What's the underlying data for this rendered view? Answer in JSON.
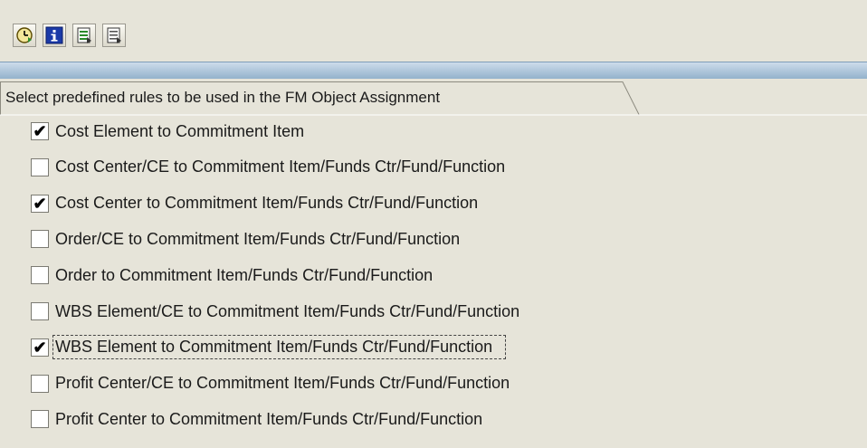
{
  "toolbar": {
    "buttons": [
      {
        "icon": "execute-clock-icon"
      },
      {
        "icon": "information-icon"
      },
      {
        "icon": "select-all-icon"
      },
      {
        "icon": "deselect-all-icon"
      }
    ]
  },
  "group": {
    "title": "Select  predefined rules to be used in the FM Object  Assignment"
  },
  "rules": [
    {
      "label": "Cost Element to Commitment Item",
      "checked": true,
      "focused": false
    },
    {
      "label": "Cost Center/CE to Commitment Item/Funds Ctr/Fund/Function",
      "checked": false,
      "focused": false
    },
    {
      "label": "Cost Center to Commitment Item/Funds Ctr/Fund/Function",
      "checked": true,
      "focused": false
    },
    {
      "label": "Order/CE to Commitment Item/Funds Ctr/Fund/Function",
      "checked": false,
      "focused": false
    },
    {
      "label": "Order to Commitment Item/Funds Ctr/Fund/Function",
      "checked": false,
      "focused": false
    },
    {
      "label": "WBS Element/CE to Commitment Item/Funds Ctr/Fund/Function",
      "checked": false,
      "focused": false
    },
    {
      "label": "WBS Element to Commitment Item/Funds Ctr/Fund/Function",
      "checked": true,
      "focused": true
    },
    {
      "label": "Profit Center/CE to Commitment Item/Funds Ctr/Fund/Function",
      "checked": false,
      "focused": false
    },
    {
      "label": "Profit Center to Commitment Item/Funds Ctr/Fund/Function",
      "checked": false,
      "focused": false
    }
  ]
}
